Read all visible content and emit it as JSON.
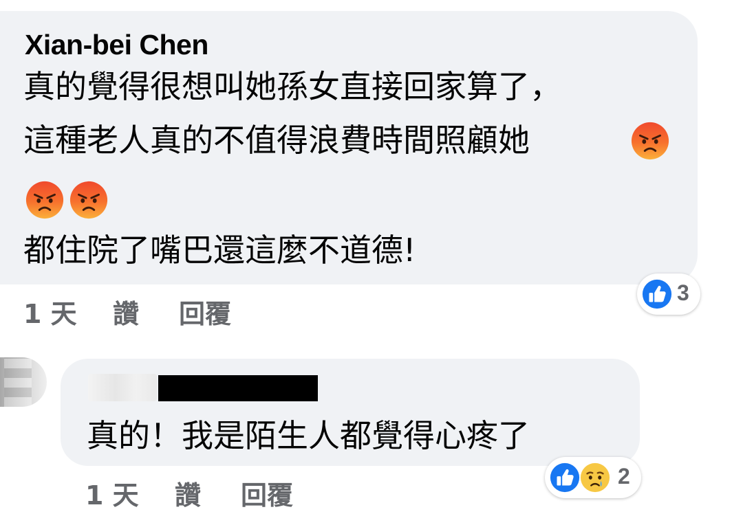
{
  "comments": [
    {
      "author": "Xian-bei Chen",
      "line1": "真的覺得很想叫她孫女直接回家算了，",
      "line2": "這種老人真的不值得浪費時間照顧她",
      "line3": "都住院了嘴巴還這麼不道德!",
      "emojis": [
        "angry-face",
        "angry-face",
        "angry-face"
      ],
      "reactions": {
        "icons": [
          "like"
        ],
        "count": "3"
      },
      "time": "1 天",
      "like_label": "讚",
      "reply_label": "回覆"
    },
    {
      "author_redacted": true,
      "text": "真的！我是陌生人都覺得心疼了",
      "reactions": {
        "icons": [
          "like",
          "sad"
        ],
        "count": "2"
      },
      "time": "1 天",
      "like_label": "讚",
      "reply_label": "回覆"
    }
  ],
  "colors": {
    "bubble": "#f0f2f5",
    "text": "#050505",
    "secondary": "#65676b",
    "like_blue": "#1877f2",
    "angry_top": "#f7712d",
    "sad_yellow": "#f7c844"
  }
}
